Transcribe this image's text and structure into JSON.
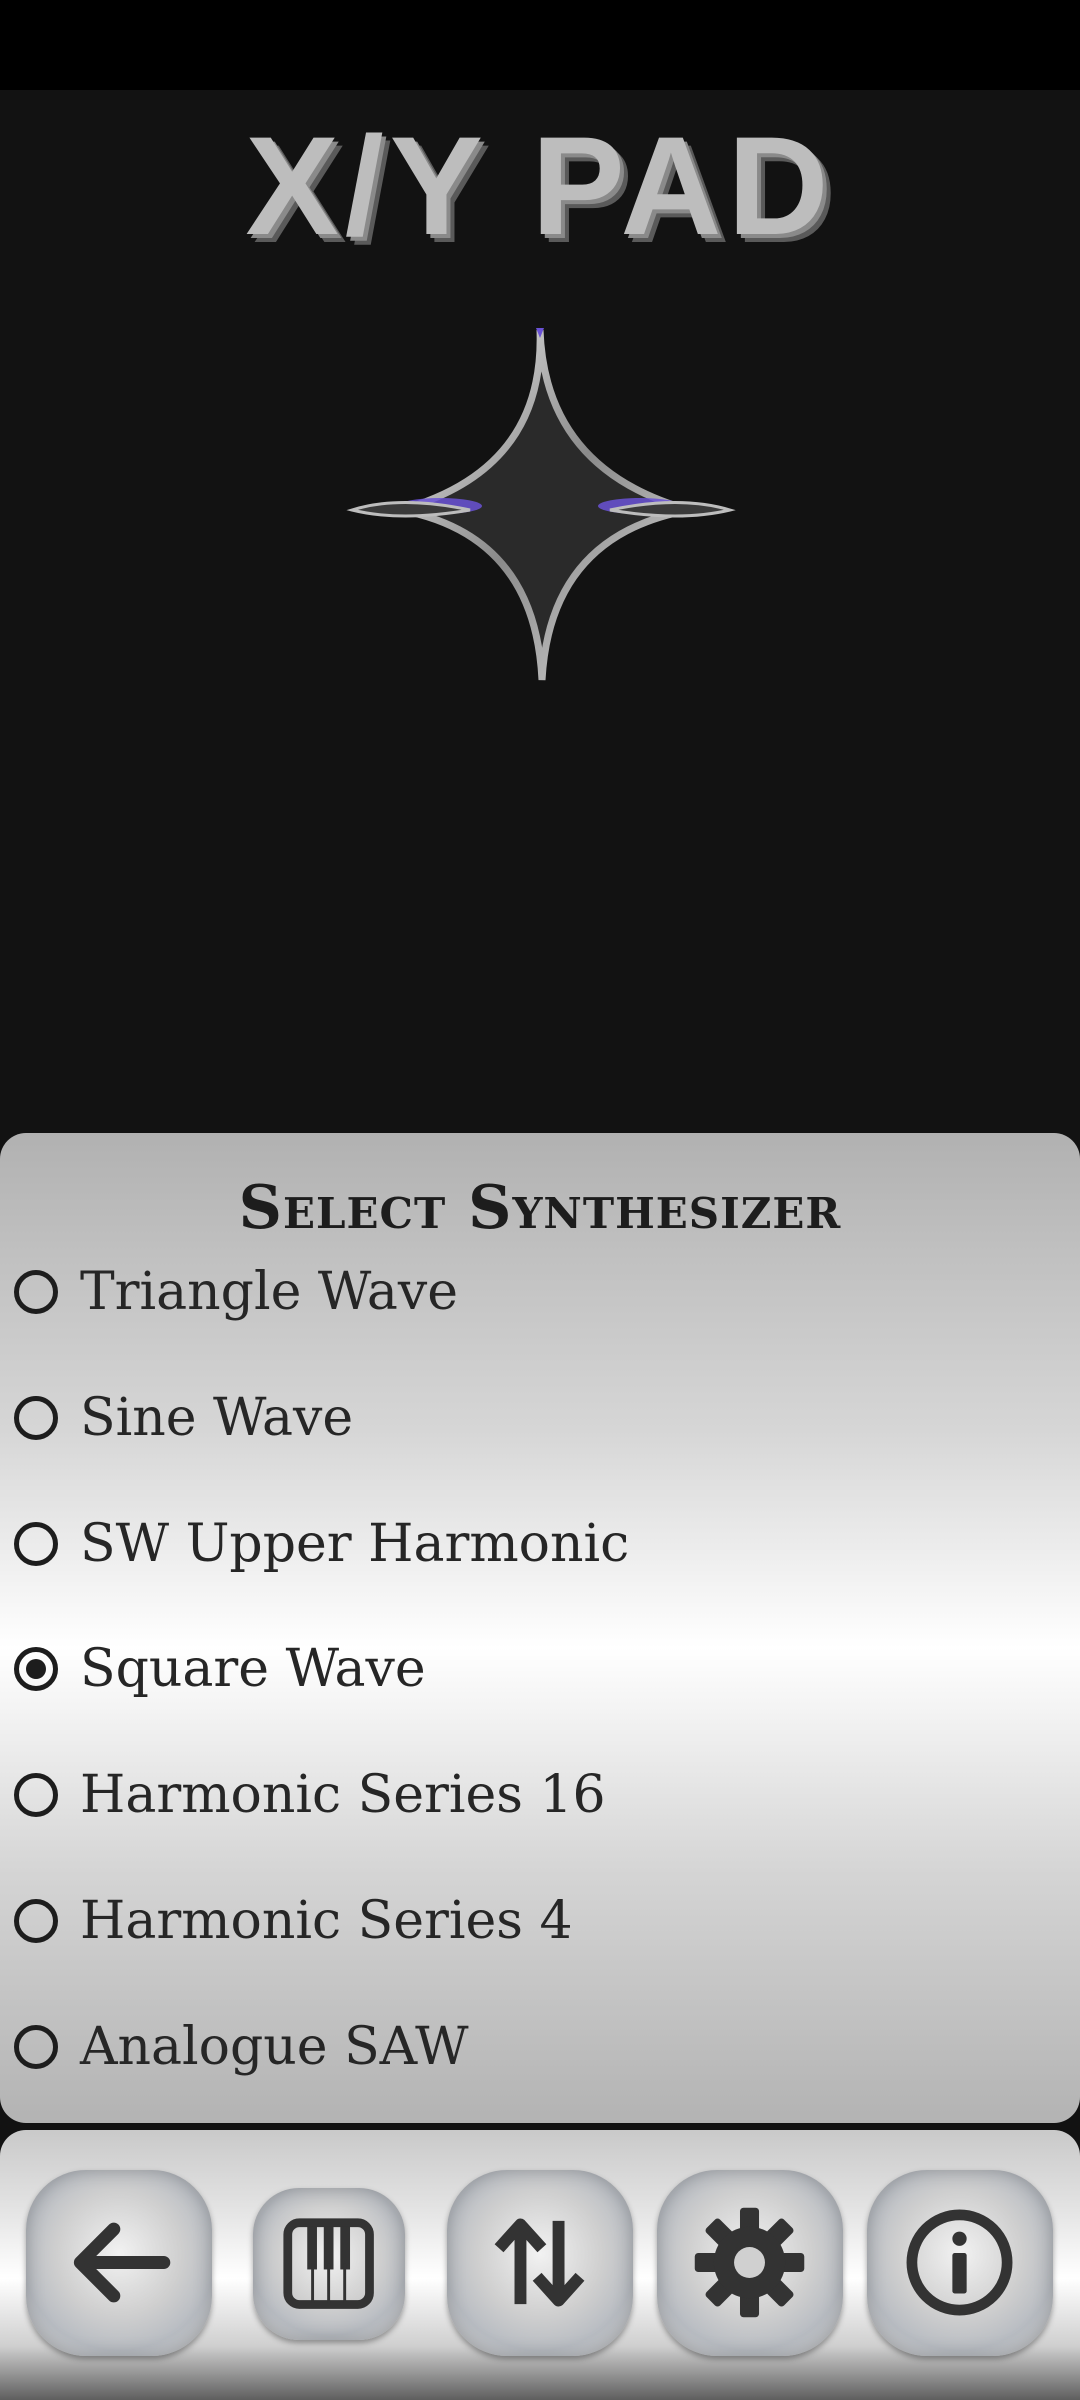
{
  "app": {
    "title": "X/Y PAD"
  },
  "synth_sheet": {
    "title": "Select Synthesizer",
    "options": [
      {
        "label": "Triangle Wave",
        "selected": false
      },
      {
        "label": "Sine Wave",
        "selected": false
      },
      {
        "label": "SW Upper Harmonic",
        "selected": false
      },
      {
        "label": "Square Wave",
        "selected": true
      },
      {
        "label": "Harmonic Series 16",
        "selected": false
      },
      {
        "label": "Harmonic Series 4",
        "selected": false
      },
      {
        "label": "Analogue SAW",
        "selected": false
      }
    ]
  },
  "nav": {
    "buttons": [
      {
        "icon": "back-arrow-icon"
      },
      {
        "icon": "piano-keys-icon"
      },
      {
        "icon": "up-down-arrows-icon"
      },
      {
        "icon": "gear-icon"
      },
      {
        "icon": "info-icon"
      }
    ]
  },
  "colors": {
    "accent": "#6a52d6",
    "background": "#121212",
    "icon": "#333333"
  }
}
